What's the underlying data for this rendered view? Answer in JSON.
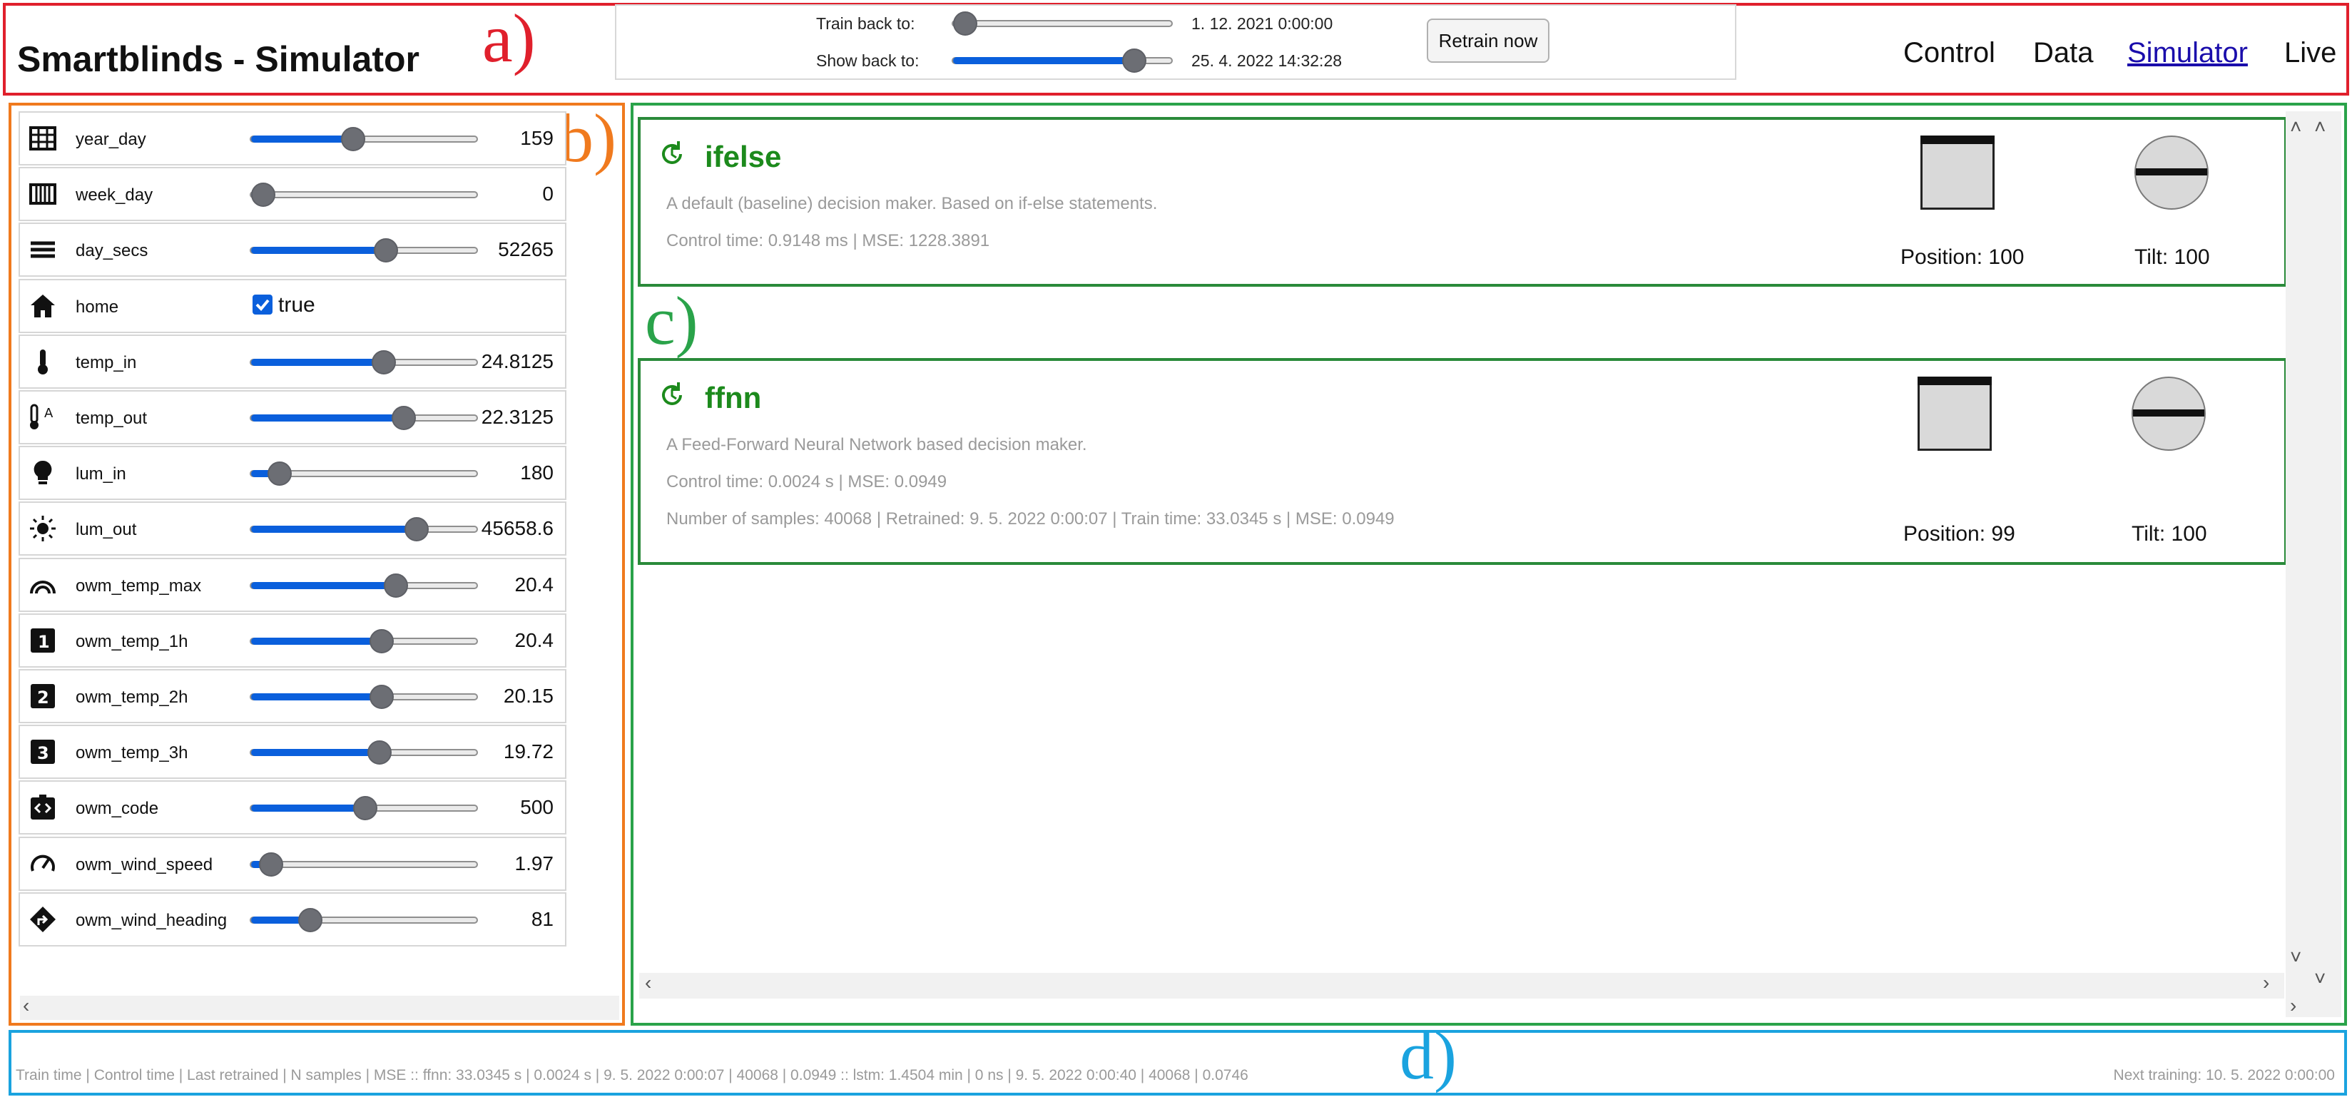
{
  "annotations": {
    "a": "a)",
    "b": "b)",
    "c": "c)",
    "d": "d)"
  },
  "header": {
    "title": "Smartblinds - Simulator",
    "train_back_label": "Train back to:",
    "train_back_value": "1. 12. 2021 0:00:00",
    "train_back_fraction": 0.0,
    "show_back_label": "Show back to:",
    "show_back_value": "25. 4. 2022 14:32:28",
    "show_back_fraction": 0.86,
    "retrain_label": "Retrain now",
    "nav": [
      {
        "label": "Control",
        "active": false
      },
      {
        "label": "Data",
        "active": false
      },
      {
        "label": "Simulator",
        "active": true
      },
      {
        "label": "Live",
        "active": false
      }
    ]
  },
  "inputs": [
    {
      "name": "year_day",
      "value": "159",
      "fraction": 0.44,
      "icon": "calendar-grid-icon"
    },
    {
      "name": "week_day",
      "value": "0",
      "fraction": 0.0,
      "icon": "week-columns-icon"
    },
    {
      "name": "day_secs",
      "value": "52265",
      "fraction": 0.6,
      "icon": "horizontal-lines-icon"
    },
    {
      "name": "home",
      "value": "true",
      "checked": true,
      "icon": "house-icon"
    },
    {
      "name": "temp_in",
      "value": "24.8125",
      "fraction": 0.59,
      "icon": "thermometer-icon"
    },
    {
      "name": "temp_out",
      "value": "22.3125",
      "fraction": 0.69,
      "icon": "thermometer-outside-icon"
    },
    {
      "name": "lum_in",
      "value": "180",
      "fraction": 0.08,
      "icon": "lightbulb-icon"
    },
    {
      "name": "lum_out",
      "value": "45658.6",
      "fraction": 0.75,
      "icon": "sun-icon"
    },
    {
      "name": "owm_temp_max",
      "value": "20.4",
      "fraction": 0.65,
      "icon": "arc-icon"
    },
    {
      "name": "owm_temp_1h",
      "value": "20.4",
      "fraction": 0.58,
      "icon": "number-1-icon"
    },
    {
      "name": "owm_temp_2h",
      "value": "20.15",
      "fraction": 0.58,
      "icon": "number-2-icon"
    },
    {
      "name": "owm_temp_3h",
      "value": "19.72",
      "fraction": 0.57,
      "icon": "number-3-icon"
    },
    {
      "name": "owm_code",
      "value": "500",
      "fraction": 0.5,
      "icon": "code-badge-icon"
    },
    {
      "name": "owm_wind_speed",
      "value": "1.97",
      "fraction": 0.04,
      "icon": "speedometer-icon"
    },
    {
      "name": "owm_wind_heading",
      "value": "81",
      "fraction": 0.23,
      "icon": "direction-sign-icon"
    }
  ],
  "models": [
    {
      "name": "ifelse",
      "description": "A default (baseline) decision maker. Based on if-else statements.",
      "stats": "Control time: 0.9148 ms | MSE: 1228.3891",
      "details": "",
      "position_label": "Position: 100",
      "tilt_label": "Tilt: 100"
    },
    {
      "name": "ffnn",
      "description": "A Feed-Forward Neural Network based decision maker.",
      "stats": "Control time: 0.0024 s | MSE: 0.0949",
      "details": "Number of samples: 40068 | Retrained: 9. 5. 2022 0:00:07 | Train time: 33.0345 s | MSE: 0.0949",
      "position_label": "Position: 99",
      "tilt_label": "Tilt: 100"
    }
  ],
  "footer": {
    "left": "Train time | Control time | Last retrained | N samples | MSE :: ffnn: 33.0345 s | 0.0024 s | 9. 5. 2022 0:00:07 | 40068 | 0.0949 :: lstm: 1.4504 min | 0 ns | 9. 5. 2022 0:00:40 | 40068 | 0.0746",
    "right": "Next training: 10. 5. 2022 0:00:00"
  },
  "colors": {
    "accent": "#0a5fdc",
    "model_title": "#1c8a1c",
    "box_a": "#e0202c",
    "box_b": "#f07a1e",
    "box_c": "#2aa34a",
    "box_d": "#1aa3df"
  }
}
